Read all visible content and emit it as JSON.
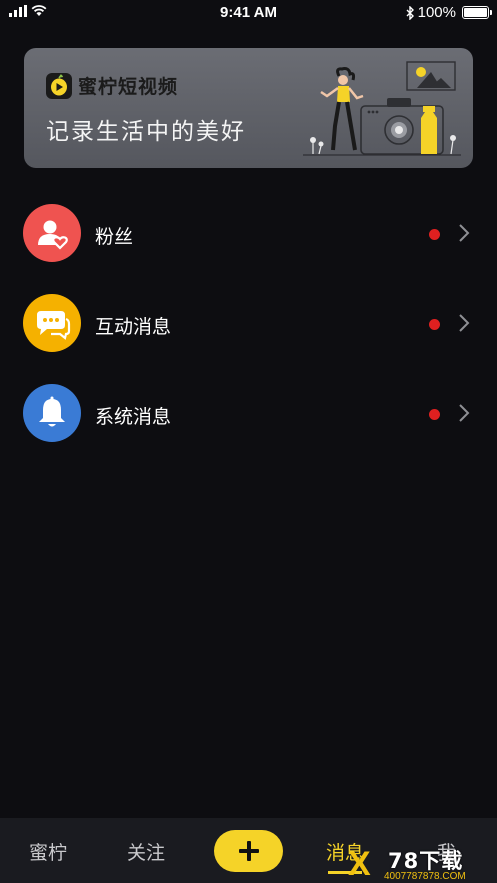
{
  "status_bar": {
    "time": "9:41 AM",
    "battery": "100%"
  },
  "banner": {
    "app_name": "蜜柠短视频",
    "slogan": "记录生活中的美好",
    "logo_icon": "play-fruit-logo-icon",
    "illustration": "girl-with-camera-illustration"
  },
  "messages": [
    {
      "label": "粉丝",
      "icon": "fan-user-heart-icon",
      "color": "#ef5350",
      "unread": true
    },
    {
      "label": "互动消息",
      "icon": "chat-bubbles-icon",
      "color": "#f5b100",
      "unread": true
    },
    {
      "label": "系统消息",
      "icon": "bell-icon",
      "color": "#3a7bd5",
      "unread": true
    }
  ],
  "tab_bar": {
    "tabs": [
      {
        "label": "蜜柠"
      },
      {
        "label": "关注"
      },
      {
        "label": "消息"
      },
      {
        "label": "我"
      }
    ],
    "active_tab": "消息",
    "add_icon": "plus-icon",
    "accent": "#f5d328"
  },
  "watermark": {
    "mark": "X",
    "brand": "78下载",
    "url": "4007787878.COM"
  }
}
